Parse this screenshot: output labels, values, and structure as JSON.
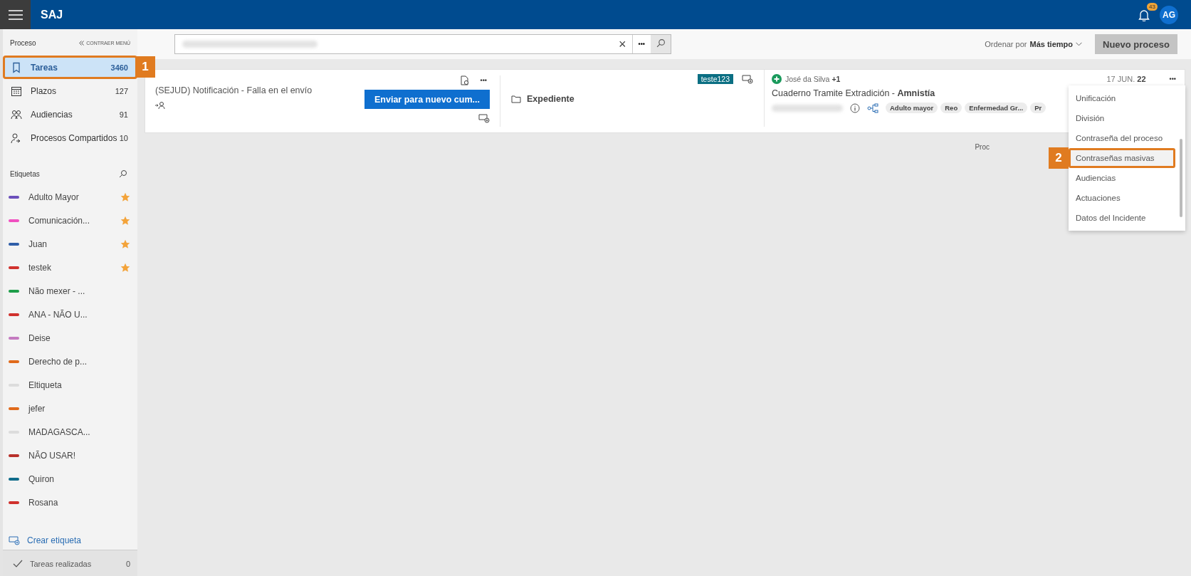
{
  "app": {
    "title": "SAJ",
    "notifications": "43",
    "avatar": "AG"
  },
  "sidebar": {
    "section": "Proceso",
    "collapse": "CONTRAER MENÚ",
    "items": [
      {
        "label": "Tareas",
        "count": "3460",
        "selected": true,
        "callout": "1"
      },
      {
        "label": "Plazos",
        "count": "127",
        "selected": false
      },
      {
        "label": "Audiencias",
        "count": "91",
        "selected": false
      },
      {
        "label": "Procesos Compartidos",
        "count": "10",
        "selected": false
      }
    ],
    "tags_title": "Etiquetas",
    "tags": [
      {
        "label": "Adulto Mayor",
        "color": "#6b4fbb",
        "starred": true
      },
      {
        "label": "Comunicación...",
        "color": "#f050c0",
        "starred": true
      },
      {
        "label": "Juan",
        "color": "#2f5ea8",
        "starred": true
      },
      {
        "label": "testek",
        "color": "#d0312d",
        "starred": true
      },
      {
        "label": "Não mexer - ...",
        "color": "#1e9e4a",
        "starred": false
      },
      {
        "label": "ANA - NÃO U...",
        "color": "#d0312d",
        "starred": false
      },
      {
        "label": "Deise",
        "color": "#c47ac0",
        "starred": false
      },
      {
        "label": "Derecho de p...",
        "color": "#e06a1b",
        "starred": false
      },
      {
        "label": "Eltiqueta",
        "color": "#dcdcdc",
        "starred": false
      },
      {
        "label": "jefer",
        "color": "#e06a1b",
        "starred": false
      },
      {
        "label": "MADAGASCA...",
        "color": "#dcdcdc",
        "starred": false
      },
      {
        "label": "NÃO USAR!",
        "color": "#b8302a",
        "starred": false
      },
      {
        "label": "Quiron",
        "color": "#0f6b8a",
        "starred": false
      },
      {
        "label": "Rosana",
        "color": "#d0312d",
        "starred": false
      }
    ],
    "create_tag": "Crear etiqueta",
    "done": {
      "label": "Tareas realizadas",
      "count": "0"
    }
  },
  "toolbar": {
    "clear": "×",
    "more": "•••",
    "sort_label": "Ordenar por",
    "sort_value": "Más tiempo",
    "new_button": "Nuevo proceso"
  },
  "card": {
    "title": "(SEJUD) Notificación - Falla en el envío",
    "action": "Enviar para nuevo cum...",
    "more": "•••",
    "badge": "teste123",
    "folder": "Expediente",
    "participant": "José da Silva",
    "participant_extra": "+1",
    "subject": "Cuaderno Tramite Extradición - **Amnistía**",
    "tags": [
      "Adulto mayor",
      "Reo",
      "Enfermedad Gr...",
      "Pr"
    ],
    "date": "17 JUN.",
    "date_day": "22",
    "more_right": "•••"
  },
  "behind_text": "Proc",
  "menu": {
    "items": [
      {
        "label": "Unificación",
        "selected": false
      },
      {
        "label": "División",
        "selected": false
      },
      {
        "label": "Contraseña del proceso",
        "selected": false
      },
      {
        "label": "Contraseñas masivas",
        "selected": true,
        "callout": "2"
      },
      {
        "label": "Audiencias",
        "selected": false
      },
      {
        "label": "Actuaciones",
        "selected": false
      },
      {
        "label": "Datos del Incidente",
        "selected": false
      }
    ]
  }
}
